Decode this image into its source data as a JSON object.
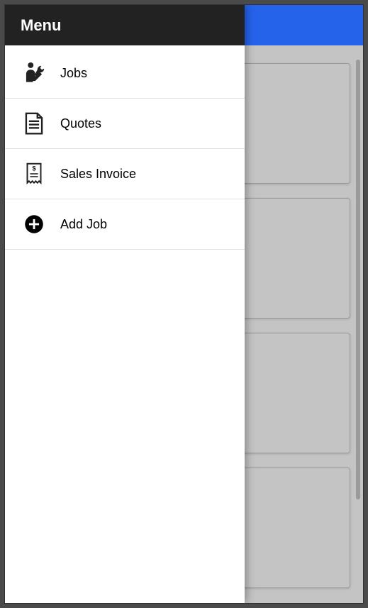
{
  "drawer": {
    "title": "Menu",
    "items": [
      {
        "label": "Jobs",
        "icon": "jobs-icon"
      },
      {
        "label": "Quotes",
        "icon": "quotes-icon"
      },
      {
        "label": "Sales Invoice",
        "icon": "sales-invoice-icon"
      },
      {
        "label": "Add Job",
        "icon": "add-job-icon"
      }
    ]
  }
}
